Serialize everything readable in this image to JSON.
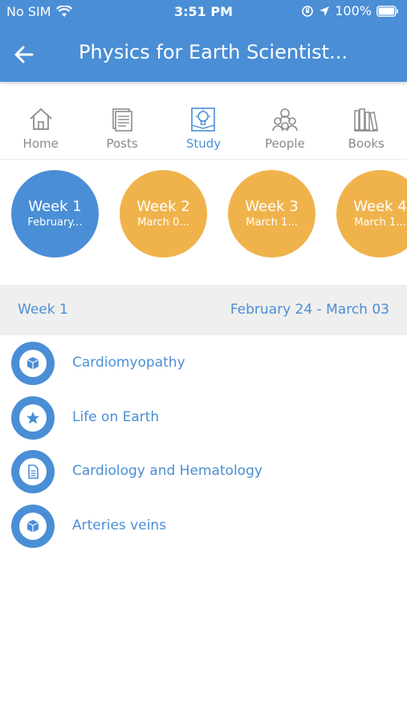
{
  "status_bar": {
    "carrier": "No SIM",
    "time": "3:51 PM",
    "battery": "100%"
  },
  "nav": {
    "back_icon": "arrow-left-icon",
    "title": "Physics for Earth Scientist..."
  },
  "tabs": [
    {
      "label": "Home",
      "icon": "home-icon",
      "active": false
    },
    {
      "label": "Posts",
      "icon": "posts-icon",
      "active": false
    },
    {
      "label": "Study",
      "icon": "study-icon",
      "active": true
    },
    {
      "label": "People",
      "icon": "people-icon",
      "active": false
    },
    {
      "label": "Books",
      "icon": "books-icon",
      "active": false
    }
  ],
  "weeks": [
    {
      "label": "Week 1",
      "date": "February...",
      "active": true
    },
    {
      "label": "Week 2",
      "date": "March 0...",
      "active": false
    },
    {
      "label": "Week 3",
      "date": "March 1...",
      "active": false
    },
    {
      "label": "Week 4",
      "date": "March 1...",
      "active": false
    }
  ],
  "section": {
    "week": "Week 1",
    "range": "February 24 -  March 03"
  },
  "items": [
    {
      "label": "Cardiomyopathy",
      "icon": "cube-icon"
    },
    {
      "label": "Life on Earth",
      "icon": "star-icon"
    },
    {
      "label": "Cardiology and Hematology",
      "icon": "document-icon"
    },
    {
      "label": "Arteries veins",
      "icon": "cube-icon"
    }
  ],
  "colors": {
    "primary": "#4a8ed6",
    "week_inactive": "#f0b34c",
    "tab_inactive": "#8a8a8a",
    "section_bg": "#efefef"
  }
}
